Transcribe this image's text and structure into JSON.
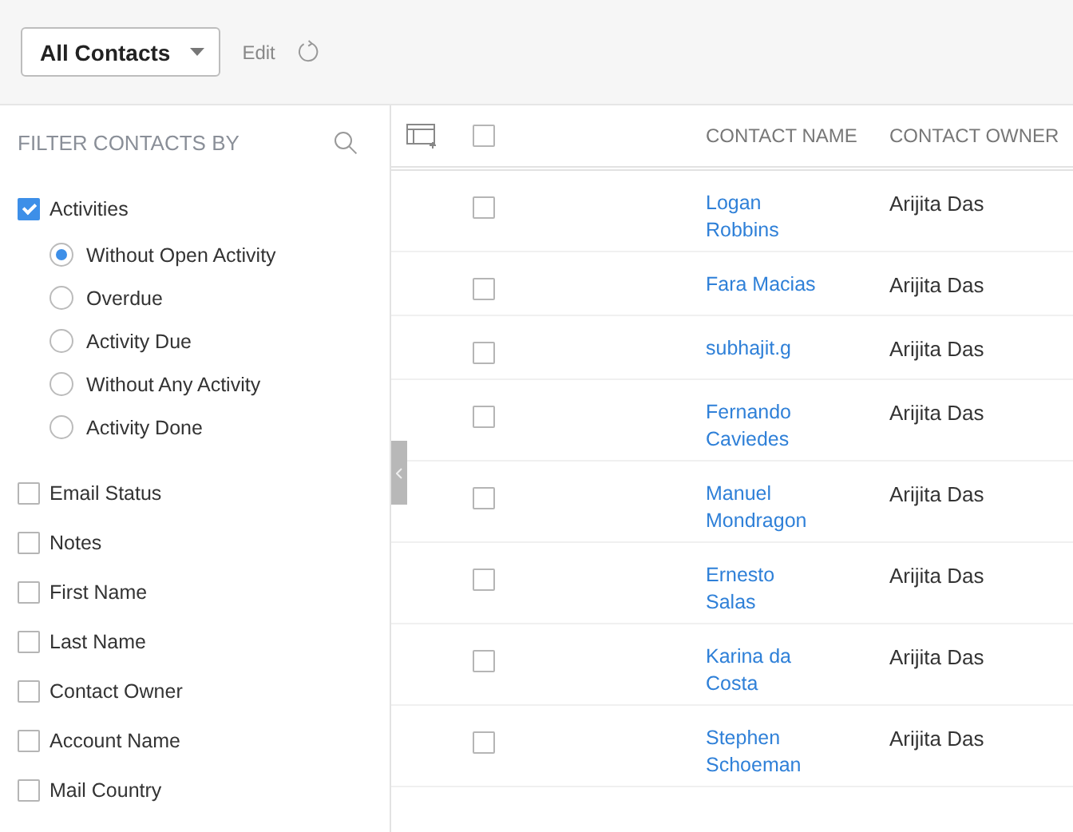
{
  "toolbar": {
    "view_selector": "All Contacts",
    "edit_link": "Edit"
  },
  "filter_panel": {
    "title": "FILTER CONTACTS BY",
    "filters": [
      {
        "label": "Activities",
        "checked": true,
        "children": [
          {
            "label": "Without Open Activity",
            "selected": true
          },
          {
            "label": "Overdue",
            "selected": false
          },
          {
            "label": "Activity Due",
            "selected": false
          },
          {
            "label": "Without Any Activity",
            "selected": false
          },
          {
            "label": "Activity Done",
            "selected": false
          }
        ]
      },
      {
        "label": "Email Status",
        "checked": false
      },
      {
        "label": "Notes",
        "checked": false
      },
      {
        "label": "First Name",
        "checked": false
      },
      {
        "label": "Last Name",
        "checked": false
      },
      {
        "label": "Contact Owner",
        "checked": false
      },
      {
        "label": "Account Name",
        "checked": false
      },
      {
        "label": "Mail Country",
        "checked": false
      }
    ]
  },
  "table": {
    "select_all_checked": false,
    "columns": [
      "CONTACT NAME",
      "CONTACT OWNER"
    ],
    "rows": [
      {
        "checked": false,
        "name": "Logan Robbins",
        "owner": "Arijita Das"
      },
      {
        "checked": false,
        "name": "Fara Macias",
        "owner": "Arijita Das"
      },
      {
        "checked": false,
        "name": "subhajit.g",
        "owner": "Arijita Das"
      },
      {
        "checked": false,
        "name": "Fernando Caviedes",
        "owner": "Arijita Das"
      },
      {
        "checked": false,
        "name": "Manuel Mondragon",
        "owner": "Arijita Das"
      },
      {
        "checked": false,
        "name": "Ernesto Salas",
        "owner": "Arijita Das"
      },
      {
        "checked": false,
        "name": "Karina da Costa",
        "owner": "Arijita Das"
      },
      {
        "checked": false,
        "name": "Stephen Schoeman",
        "owner": "Arijita Das"
      }
    ]
  }
}
